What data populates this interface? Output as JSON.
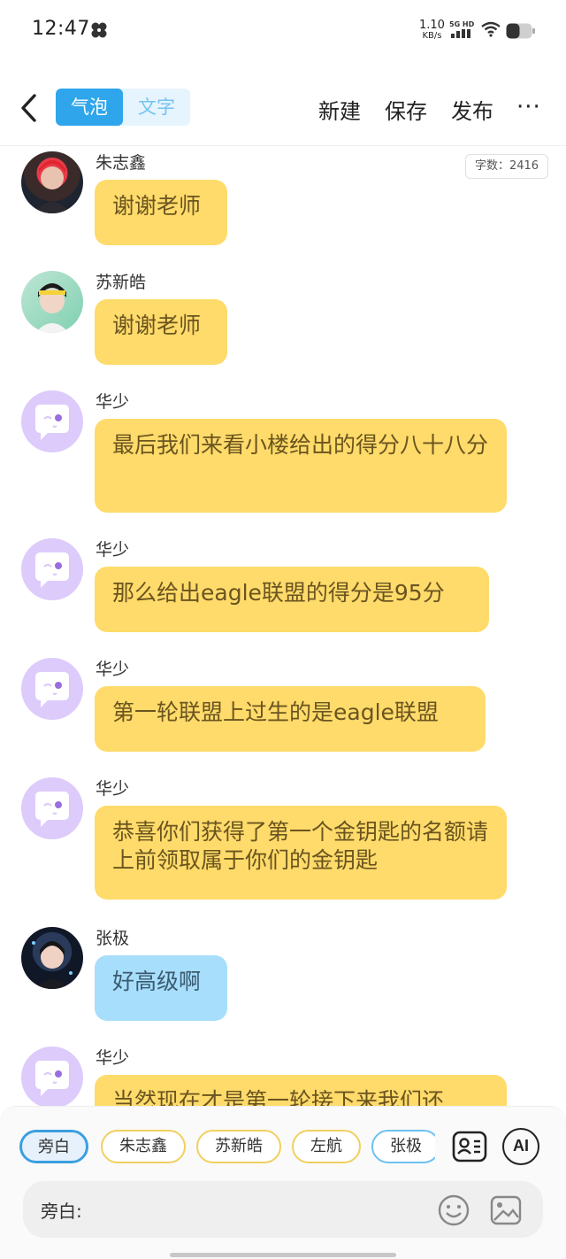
{
  "status": {
    "time": "12:47",
    "speed_value": "1.10",
    "speed_unit": "KB/s",
    "network": "5G HD"
  },
  "topbar": {
    "tabs": [
      {
        "label": "气泡",
        "active": true
      },
      {
        "label": "文字",
        "active": false
      }
    ],
    "new_label": "新建",
    "save_label": "保存",
    "publish_label": "发布",
    "more_label": "···"
  },
  "word_count": "字数：2416",
  "messages": [
    {
      "name": "朱志鑫",
      "text": "谢谢老师",
      "color": "yellow"
    },
    {
      "name": "苏新皓",
      "text": "谢谢老师",
      "color": "yellow"
    },
    {
      "name": "华少",
      "text": "最后我们来看小楼给出的得分八十八分",
      "color": "yellow"
    },
    {
      "name": "华少",
      "text": "那么给出eagle联盟的得分是95分",
      "color": "yellow"
    },
    {
      "name": "华少",
      "text": "第一轮联盟上过生的是eagle联盟",
      "color": "yellow"
    },
    {
      "name": "华少",
      "text": "恭喜你们获得了第一个金钥匙的名额请上前领取属于你们的金钥匙",
      "color": "yellow"
    },
    {
      "name": "张极",
      "text": "好高级啊",
      "color": "blue"
    },
    {
      "name": "华少",
      "text": "当然现在才是第一轮接下来我们还",
      "color": "yellow"
    }
  ],
  "chips": [
    "旁白",
    "朱志鑫",
    "苏新皓",
    "左航",
    "张极"
  ],
  "ai_label": "AI",
  "input_label": "旁白:",
  "colors": {
    "accent": "#2fa6ec",
    "bubble_yellow": "#fedb6a",
    "bubble_blue": "#a7defc",
    "narrator_avatar": "#dccbfb"
  }
}
